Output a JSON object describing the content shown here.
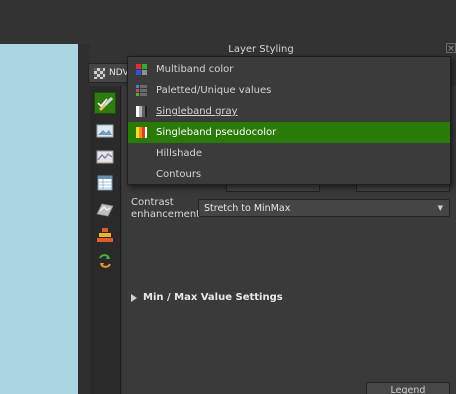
{
  "panel": {
    "title": "Layer Styling",
    "close_glyph": "×"
  },
  "layer_selector": {
    "label": "NDV",
    "icon": "checker-icon"
  },
  "toolbar": {
    "tools": [
      {
        "id": "symbology",
        "icon": "paintbrush-icon",
        "active": true
      },
      {
        "id": "transparency",
        "icon": "raster-image-icon"
      },
      {
        "id": "histogram",
        "icon": "histogram-icon"
      },
      {
        "id": "attribute",
        "icon": "table-icon"
      },
      {
        "id": "rendering",
        "icon": "terrain-icon"
      },
      {
        "id": "pyramids",
        "icon": "pyramid-icon"
      },
      {
        "id": "history",
        "icon": "undo-arrows-icon"
      }
    ]
  },
  "renderer_dropdown": {
    "items": [
      {
        "label": "Multiband color",
        "icon": "multiband-icon"
      },
      {
        "label": "Paletted/Unique values",
        "icon": "paletted-icon"
      },
      {
        "label": "Singleband gray",
        "icon": "singleband-gray-icon",
        "hovered": true
      },
      {
        "label": "Singleband pseudocolor",
        "icon": "pseudocolor-icon",
        "selected": true
      },
      {
        "label": "Hillshade",
        "icon": ""
      },
      {
        "label": "Contours",
        "icon": ""
      }
    ]
  },
  "contrast": {
    "label": "Contrast enhancement",
    "value": "Stretch to MinMax",
    "arrow": "▼"
  },
  "minmax": {
    "label": "Min / Max Value Settings"
  },
  "legend_button": {
    "label": "Legend Settings..."
  },
  "colors": {
    "background": "#333333",
    "map_canvas": "#abd5e3",
    "accent_green": "#2a7a07",
    "dropdown_bg": "#3b3b3b"
  }
}
